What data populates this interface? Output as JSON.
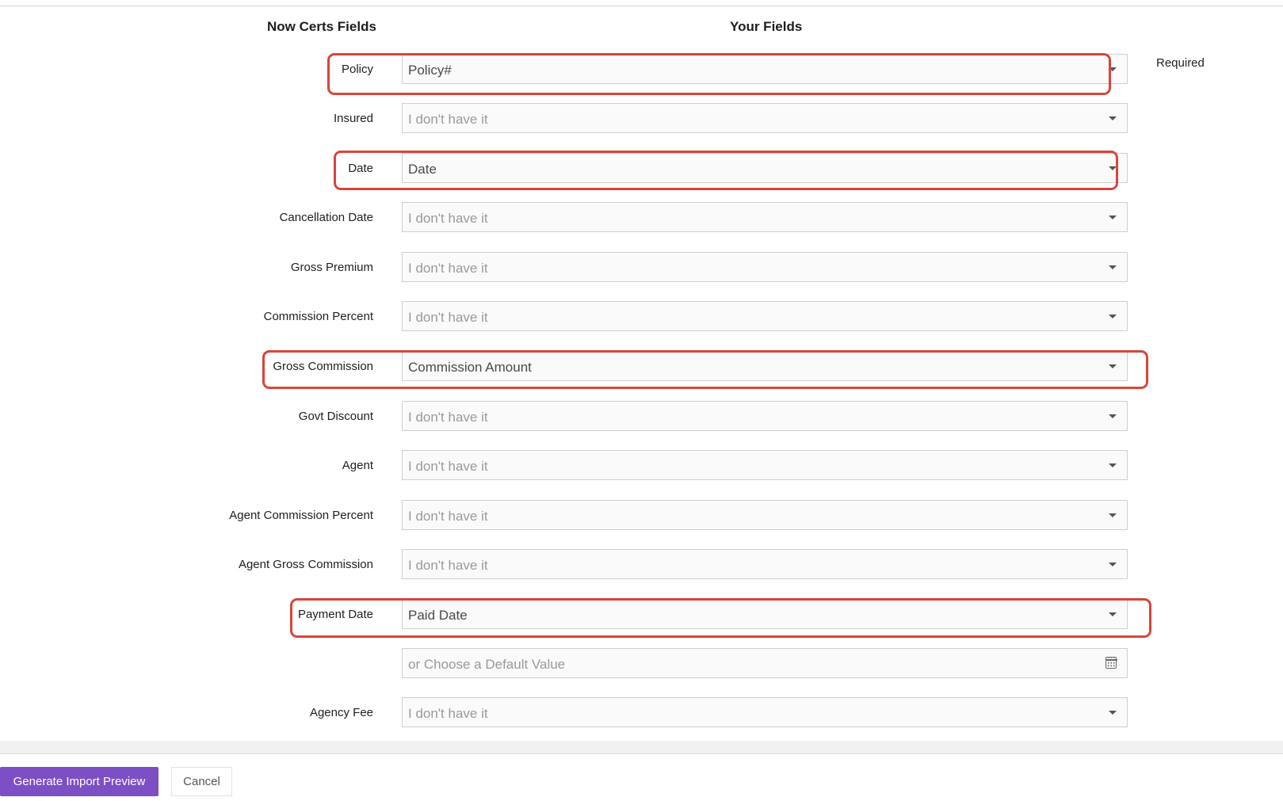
{
  "header": {
    "left_column": "Now Certs Fields",
    "right_column": "Your Fields",
    "required_note": "Required"
  },
  "rows": [
    {
      "label": "Policy",
      "value": "Policy#",
      "control": "dropdown",
      "highlighted": true
    },
    {
      "label": "Insured",
      "value": "I don't have it",
      "control": "dropdown",
      "highlighted": false
    },
    {
      "label": "Date",
      "value": "Date",
      "control": "dropdown",
      "highlighted": true
    },
    {
      "label": "Cancellation Date",
      "value": "I don't have it",
      "control": "dropdown",
      "highlighted": false
    },
    {
      "label": "Gross Premium",
      "value": "I don't have it",
      "control": "dropdown",
      "highlighted": false
    },
    {
      "label": "Commission Percent",
      "value": "I don't have it",
      "control": "dropdown",
      "highlighted": false
    },
    {
      "label": "Gross Commission",
      "value": "Commission Amount",
      "control": "dropdown",
      "highlighted": true
    },
    {
      "label": "Govt Discount",
      "value": "I don't have it",
      "control": "dropdown",
      "highlighted": false
    },
    {
      "label": "Agent",
      "value": "I don't have it",
      "control": "dropdown",
      "highlighted": false
    },
    {
      "label": "Agent Commission Percent",
      "value": "I don't have it",
      "control": "dropdown",
      "highlighted": false
    },
    {
      "label": "Agent Gross Commission",
      "value": "I don't have it",
      "control": "dropdown",
      "highlighted": false
    },
    {
      "label": "Payment Date",
      "value": "Paid Date",
      "control": "dropdown",
      "highlighted": true
    },
    {
      "label": "",
      "value": "or Choose a Default Value",
      "control": "date-input",
      "highlighted": false
    },
    {
      "label": "Agency Fee",
      "value": "I don't have it",
      "control": "dropdown",
      "highlighted": false
    }
  ],
  "icons": {
    "dropdown": "chevron-down-icon",
    "date_input": "calendar-icon"
  },
  "colors": {
    "highlight": "#d9453a",
    "primary_button": "#7c4fc4"
  },
  "actions": {
    "generate_label": "Generate Import Preview",
    "cancel_label": "Cancel"
  }
}
